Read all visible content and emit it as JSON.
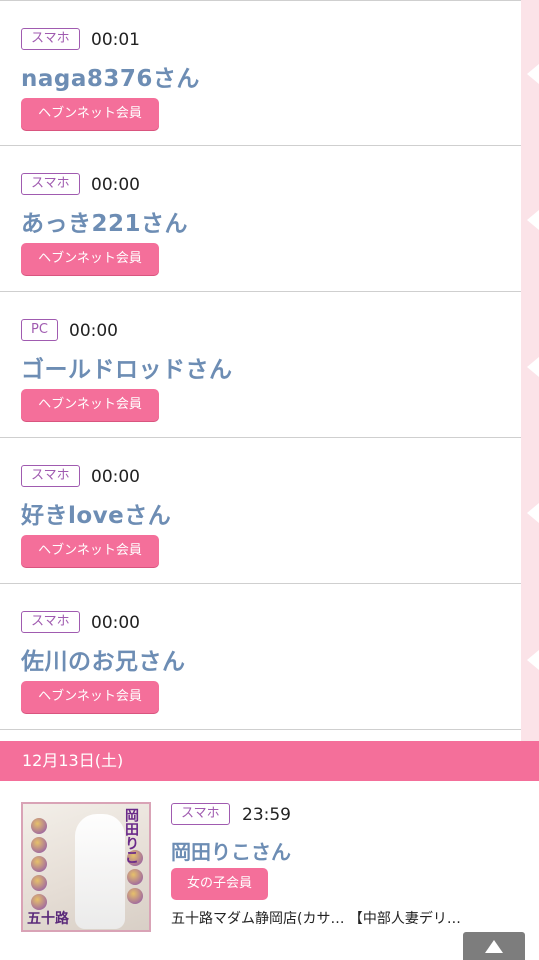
{
  "entries": [
    {
      "device": "スマホ",
      "time": "00:01",
      "name": "naga8376さん",
      "member": "ヘブンネット会員"
    },
    {
      "device": "スマホ",
      "time": "00:00",
      "name": "あっき221さん",
      "member": "ヘブンネット会員"
    },
    {
      "device": "PC",
      "time": "00:00",
      "name": "ゴールドロッドさん",
      "member": "ヘブンネット会員"
    },
    {
      "device": "スマホ",
      "time": "00:00",
      "name": "好きloveさん",
      "member": "ヘブンネット会員"
    },
    {
      "device": "スマホ",
      "time": "00:00",
      "name": "佐川のお兄さん",
      "member": "ヘブンネット会員"
    }
  ],
  "date_header": "12月13日(土)",
  "girl": {
    "device": "スマホ",
    "time": "23:59",
    "name": "岡田りこさん",
    "member": "女の子会員",
    "shop": "五十路マダム静岡店(カサ…  【中部人妻デリ…",
    "thumb_vertical_text": "岡田りこ",
    "thumb_brand": "五十路"
  },
  "colors": {
    "accent": "#f46f9a",
    "name": "#6d8db4",
    "badge": "#a05bb0",
    "strip": "#fbe3e8"
  }
}
